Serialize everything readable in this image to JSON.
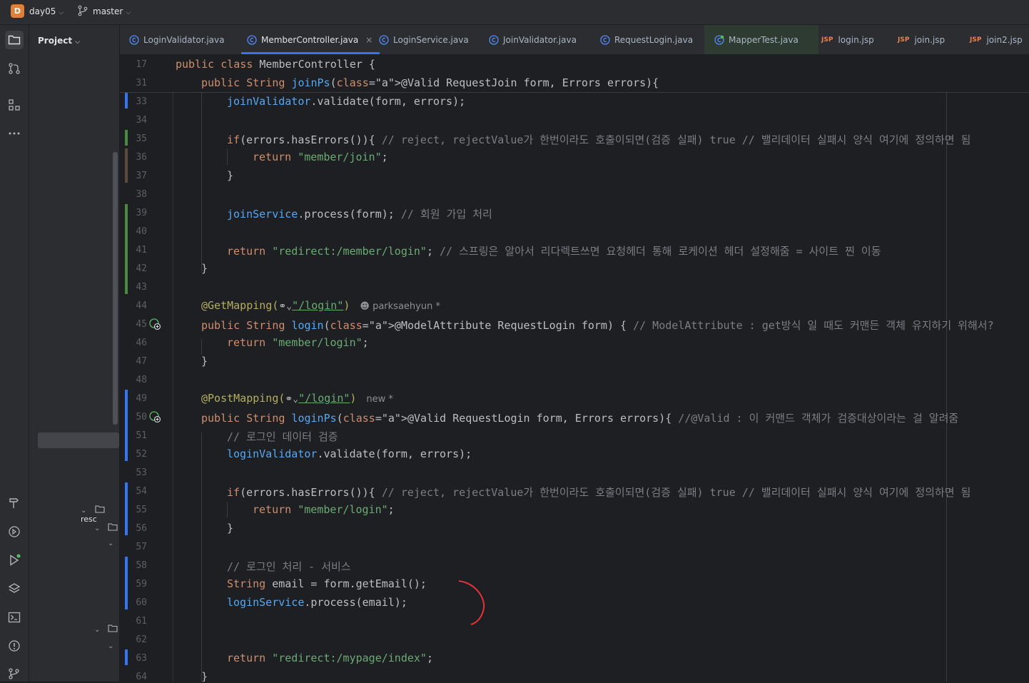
{
  "titlebar": {
    "project_badge": "D",
    "project_name": "day05",
    "branch": "master"
  },
  "project_panel": {
    "title": "Project",
    "tree_label": "resc"
  },
  "tabs": [
    {
      "label": "LoginValidator.java",
      "icon": "java-class-icon"
    },
    {
      "label": "MemberController.java",
      "icon": "java-class-icon",
      "active": true
    },
    {
      "label": "LoginService.java",
      "icon": "java-class-icon"
    },
    {
      "label": "JoinValidator.java",
      "icon": "java-class-icon"
    },
    {
      "label": "RequestLogin.java",
      "icon": "java-class-icon"
    },
    {
      "label": "MapperTest.java",
      "icon": "test-class-icon"
    },
    {
      "label": "login.jsp",
      "icon": "jsp-icon",
      "badge": "JSP"
    },
    {
      "label": "join.jsp",
      "icon": "jsp-icon",
      "badge": "JSP"
    },
    {
      "label": "join2.jsp",
      "icon": "jsp-icon",
      "badge": "JSP"
    }
  ],
  "tab_close": "×",
  "editor": {
    "line_numbers": [
      "17",
      "31",
      "33",
      "34",
      "35",
      "36",
      "37",
      "38",
      "39",
      "40",
      "41",
      "42",
      "43",
      "44",
      "45",
      "46",
      "47",
      "48",
      "49",
      "50",
      "51",
      "52",
      "53",
      "54",
      "55",
      "56",
      "57",
      "58",
      "59",
      "60",
      "61",
      "62",
      "63",
      "64"
    ],
    "sticky": {
      "class_line": "public class MemberController {",
      "method_line": "public String joinPs(@Valid RequestJoin form, Errors errors){"
    },
    "lines": {
      "l33": "joinValidator.validate(form, errors);",
      "l35_code": "if(errors.hasErrors()){",
      "l35_comment": "// reject, rejectValue가 한번이라도 호출이되면(검증 실패) true // 밸리데이터 실패시 양식 여기에 정의하면 됨",
      "l36": "return \"member/join\";",
      "l37": "}",
      "l39_code": "joinService.process(form);",
      "l39_comment": "// 회원 가입 처리",
      "l41_code": "return \"redirect:/member/login\";",
      "l41_comment": "// 스프링은 알아서 리다렉트쓰면 요청헤더 통해 로케이션 헤더 설정해줌 = 사이트 찐 이동",
      "l42": "}",
      "l44_ann": "@GetMapping(",
      "l44_path": "\"/login\"",
      "l44_close": ")",
      "l44_author": "parksaehyun *",
      "l45_code": "public String login(@ModelAttribute RequestLogin form) {",
      "l45_comment": "// ModelAttribute : get방식 일 때도 커맨든 객체 유지하기 위해서?",
      "l46": "return \"member/login\";",
      "l47": "}",
      "l49_ann": "@PostMapping(",
      "l49_path": "\"/login\"",
      "l49_close": ")",
      "l49_author": "new *",
      "l50_code": "public String loginPs(@Valid RequestLogin form, Errors errors){",
      "l50_comment": "//@Valid : 이 커맨드 객체가 검증대상이라는 걸 알려줌",
      "l51": "// 로그인 데이터 검증",
      "l52": "loginValidator.validate(form, errors);",
      "l54_code": "if(errors.hasErrors()){",
      "l54_comment": "// reject, rejectValue가 한번이라도 호출이되면(검증 실패) true // 밸리데이터 실패시 양식 여기에 정의하면 됨",
      "l55": "return \"member/login\";",
      "l56": "}",
      "l58": "// 로그인 처리 - 서비스",
      "l59": "String email = form.getEmail();",
      "l60": "loginService.process(email);",
      "l63": "return \"redirect:/mypage/index\";",
      "l64": "}"
    }
  },
  "colors": {
    "keyword": "#cf8e6d",
    "method": "#56a8f5",
    "string": "#6aab73",
    "annotation": "#b3ae60",
    "comment": "#7a7e85",
    "accent": "#3574f0",
    "change_added": "#4a8a3f",
    "change_modified": "#3574f0"
  }
}
